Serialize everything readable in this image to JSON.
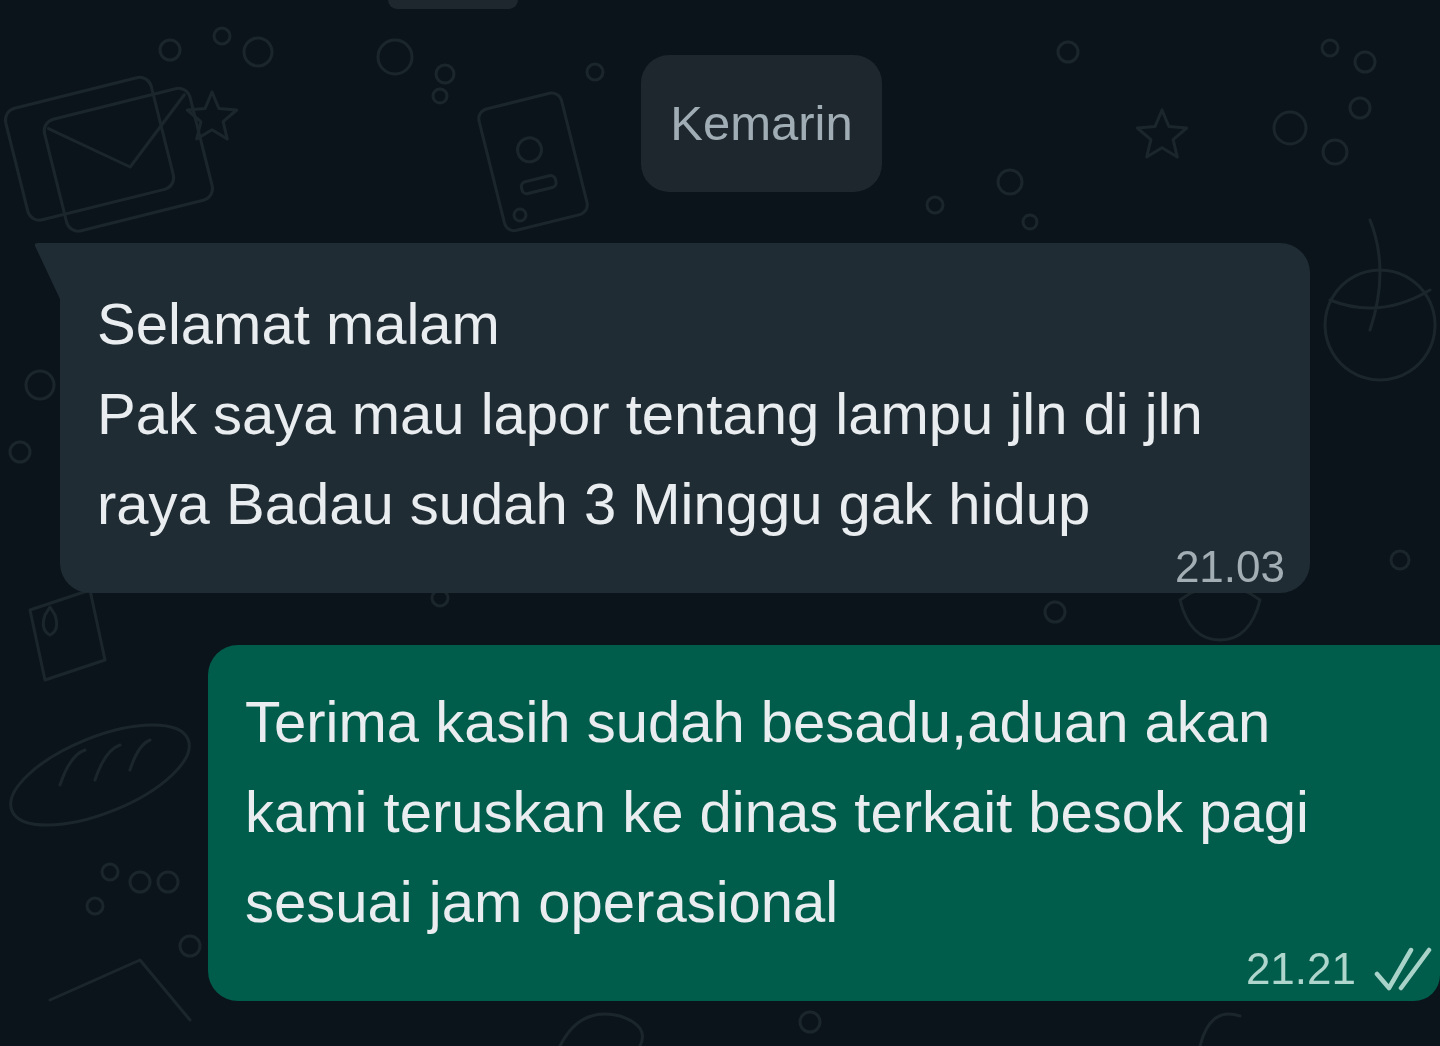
{
  "date_separator": {
    "label": "Kemarin"
  },
  "messages": [
    {
      "kind": "incoming",
      "text": "Selamat malam\nPak saya mau lapor tentang lampu jln di jln raya Badau sudah 3 Minggu gak hidup",
      "time": "21.03"
    },
    {
      "kind": "outgoing",
      "text": "Terima kasih sudah besadu,aduan akan kami teruskan ke dinas terkait besok pagi sesuai jam operasional",
      "time": "21.21",
      "read": false
    }
  ]
}
